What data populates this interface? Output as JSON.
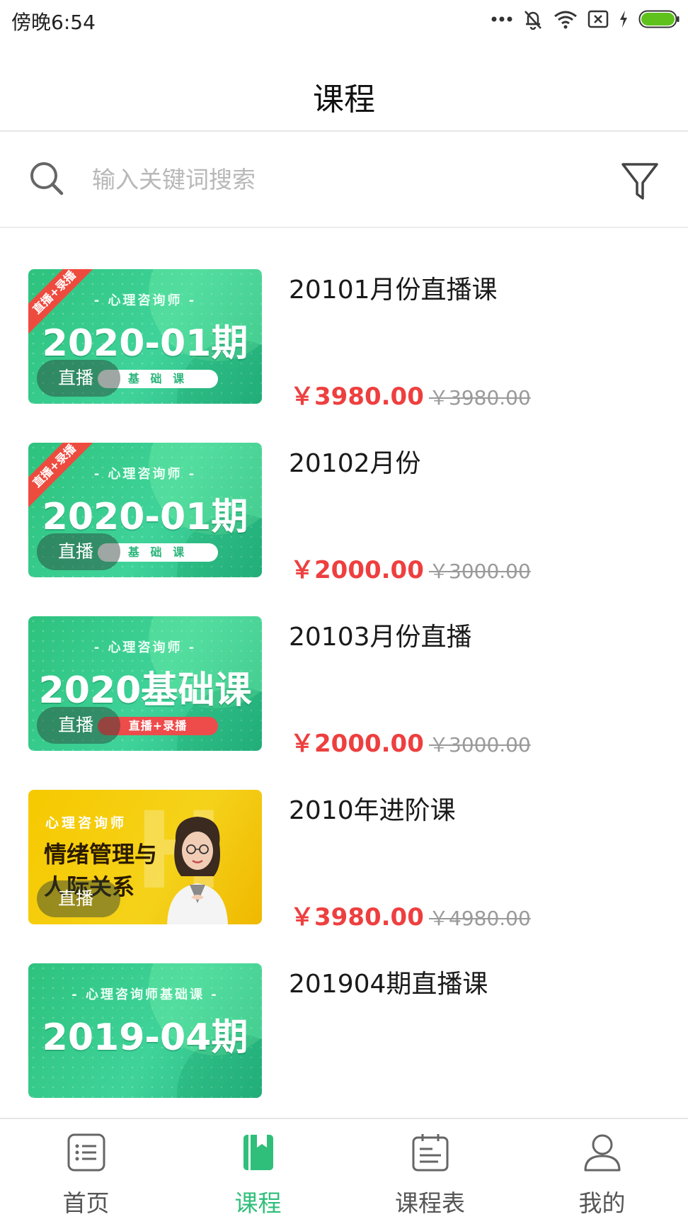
{
  "status_bar": {
    "time": "傍晚6:54"
  },
  "header": {
    "title": "课程"
  },
  "search": {
    "placeholder": "输入关键词搜索",
    "value": ""
  },
  "courses": [
    {
      "title": "20101月份直播课",
      "price": "￥3980.00",
      "original_price": "￥3980.00",
      "thumb": {
        "style": "green",
        "ribbon": "直播+录播",
        "subtitle": "- 心理咨询师 -",
        "main": "2020-01期",
        "pill": "基 础 课",
        "badge": "直播"
      }
    },
    {
      "title": "20102月份",
      "price": "￥2000.00",
      "original_price": "￥3000.00",
      "thumb": {
        "style": "green",
        "ribbon": "直播+录播",
        "subtitle": "- 心理咨询师 -",
        "main": "2020-01期",
        "pill": "基 础 课",
        "badge": "直播"
      }
    },
    {
      "title": "20103月份直播",
      "price": "￥2000.00",
      "original_price": "￥3000.00",
      "thumb": {
        "style": "green",
        "subtitle": "- 心理咨询师 -",
        "main": "2020基础课",
        "pill": "直播+录播",
        "badge": "直播"
      }
    },
    {
      "title": "2010年进阶课",
      "price": "￥3980.00",
      "original_price": "￥4980.00",
      "thumb": {
        "style": "yellow",
        "subtitle": "心理咨询师",
        "main_line1": "情绪管理与",
        "main_line2": "人际关系",
        "badge": "直播"
      }
    },
    {
      "title": "201904期直播课",
      "thumb": {
        "style": "green",
        "subtitle": "- 心理咨询师基础课 -",
        "main": "2019-04期"
      }
    }
  ],
  "tabs": [
    {
      "label": "首页",
      "icon": "home-list-icon",
      "active": false
    },
    {
      "label": "课程",
      "icon": "course-book-icon",
      "active": true
    },
    {
      "label": "课程表",
      "icon": "schedule-icon",
      "active": false
    },
    {
      "label": "我的",
      "icon": "profile-icon",
      "active": false
    }
  ],
  "colors": {
    "accent": "#2fbf7a",
    "price": "#ee3f3f",
    "ribbon": "#ee4b3f",
    "thumb_green": "#2ec27e",
    "thumb_yellow": "#f6c900"
  }
}
